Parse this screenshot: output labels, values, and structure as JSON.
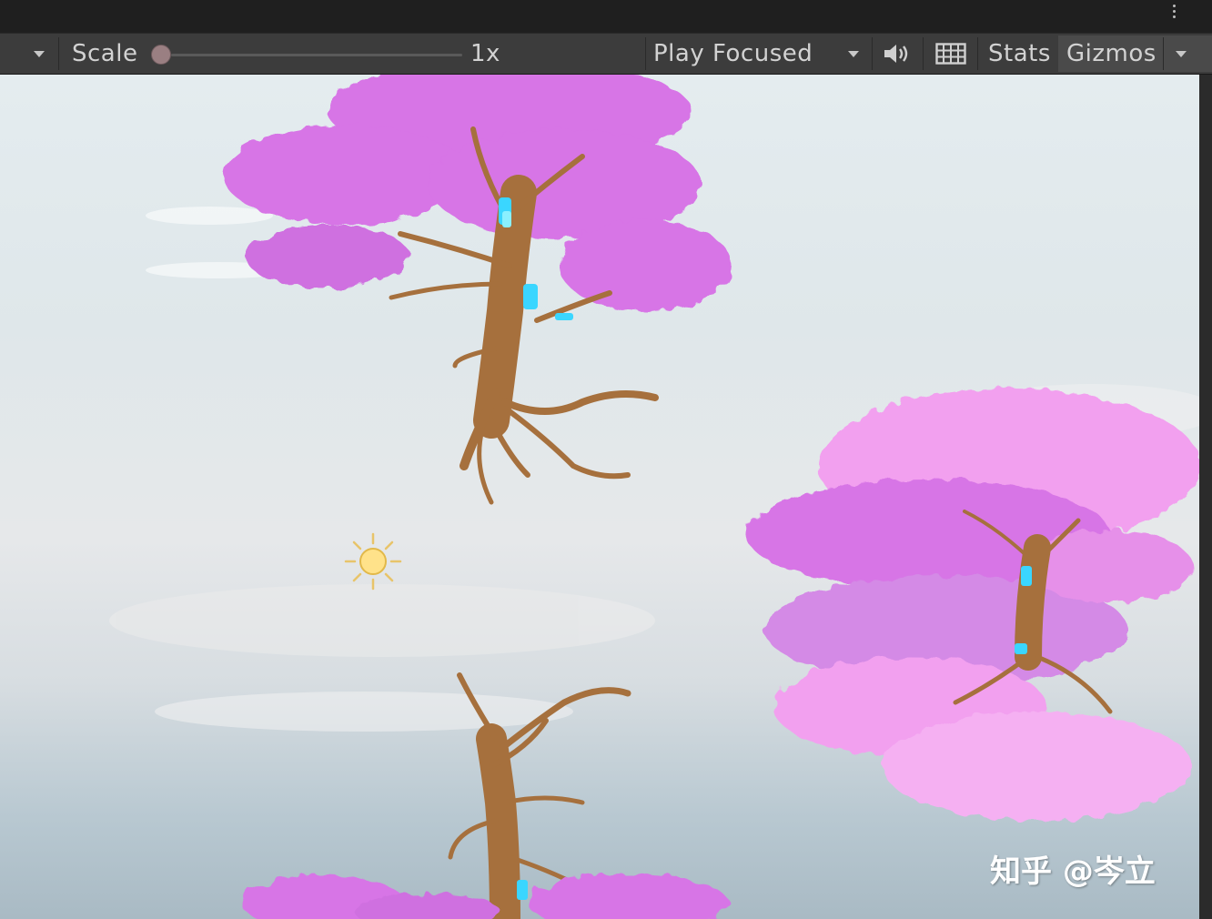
{
  "toolbar": {
    "scale_label": "Scale",
    "scale_value": "1x",
    "play_mode": "Play Focused",
    "stats_label": "Stats",
    "gizmos_label": "Gizmos"
  },
  "watermark": "知乎 @岑立",
  "colors": {
    "toolbar_bg": "#3c3c3c",
    "blossom": "#d774e6",
    "blossom_light": "#f2a0ef",
    "trunk": "#a6703d",
    "glow": "#3ad6ff",
    "sun": "#ffe28a"
  },
  "icons": [
    "dropdown-caret-icon",
    "audio-icon",
    "keyboard-grid-icon",
    "kebab-menu-icon",
    "sun-light-gizmo-icon"
  ]
}
